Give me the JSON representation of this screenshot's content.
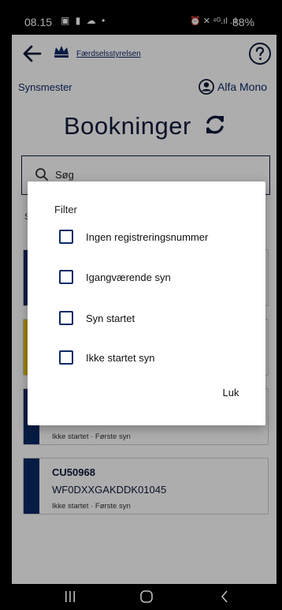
{
  "status_bar": {
    "time": "08.15",
    "left_icons": "▣ ▮ ☁ •",
    "right_icons": "⏰ ✕ ⁴ᴳ.ıl .ıl",
    "battery": "88%"
  },
  "header": {
    "agency_name": "Færdselsstyrelsen",
    "role": "Synsmester",
    "user_name": "Alfa Mono",
    "title": "Bookninger"
  },
  "search": {
    "placeholder": "Søg"
  },
  "list": {
    "label": "S",
    "items": [
      {
        "plate": "",
        "vin": "",
        "meta": "",
        "bar_color": "#0b2a66"
      },
      {
        "plate": "",
        "vin": "",
        "meta": "",
        "bar_color": "#e5c200"
      },
      {
        "plate": "",
        "vin": "",
        "meta": "Ikke startet · Første syn",
        "bar_color": "#0b2a66"
      },
      {
        "plate": "CU50968",
        "vin": "WF0DXXGAKDDK01045",
        "meta": "Ikke startet · Første syn",
        "bar_color": "#0b2a66"
      }
    ]
  },
  "filter_dialog": {
    "title": "Filter",
    "options": [
      {
        "label": "Ingen registreringsnummer",
        "checked": false
      },
      {
        "label": "Igangværende syn",
        "checked": false
      },
      {
        "label": "Syn startet",
        "checked": false
      },
      {
        "label": "Ikke startet syn",
        "checked": false
      }
    ],
    "close_label": "Luk"
  },
  "icons": {
    "back": "arrow-left-icon",
    "crown": "crown-icon",
    "help": "question-circle-icon",
    "user": "user-circle-icon",
    "refresh": "refresh-icon",
    "search": "search-icon"
  },
  "colors": {
    "primary_navy": "#0b2a66",
    "warning_yellow": "#e5c200",
    "scrim": "rgba(0,0,0,0.32)"
  }
}
